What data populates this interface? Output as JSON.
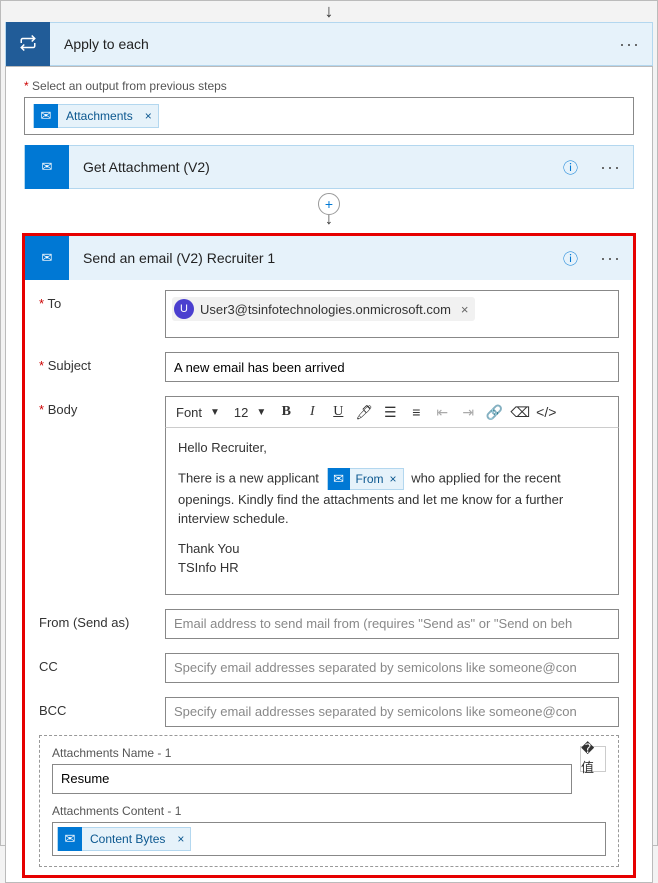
{
  "applyEach": {
    "title": "Apply to each",
    "outputLabel": "Select an output from previous steps",
    "outputChip": "Attachments"
  },
  "getAttachment": {
    "title": "Get Attachment (V2)"
  },
  "sendEmail": {
    "title": "Send an email (V2) Recruiter 1",
    "labels": {
      "to": "To",
      "subject": "Subject",
      "body": "Body",
      "from": "From (Send as)",
      "cc": "CC",
      "bcc": "BCC"
    },
    "to": {
      "avatarInitial": "U",
      "address": "User3@tsinfotechnologies.onmicrosoft.com"
    },
    "subject": "A new email has been arrived",
    "toolbar": {
      "font": "Font",
      "size": "12"
    },
    "bodyText": {
      "greeting": "Hello Recruiter,",
      "line1a": "There is a new applicant",
      "fromToken": "From",
      "line1b": "who applied for the recent openings. Kindly find the attachments and let me know for a further interview schedule.",
      "sig1": "Thank You",
      "sig2": "TSInfo HR"
    },
    "placeholders": {
      "from": "Email address to send mail from (requires \"Send as\" or \"Send on beh",
      "cc": "Specify email addresses separated by semicolons like someone@con",
      "bcc": "Specify email addresses separated by semicolons like someone@con"
    },
    "attachments": {
      "nameLabel": "Attachments Name - 1",
      "nameValue": "Resume",
      "contentLabel": "Attachments Content - 1",
      "contentToken": "Content Bytes"
    }
  }
}
